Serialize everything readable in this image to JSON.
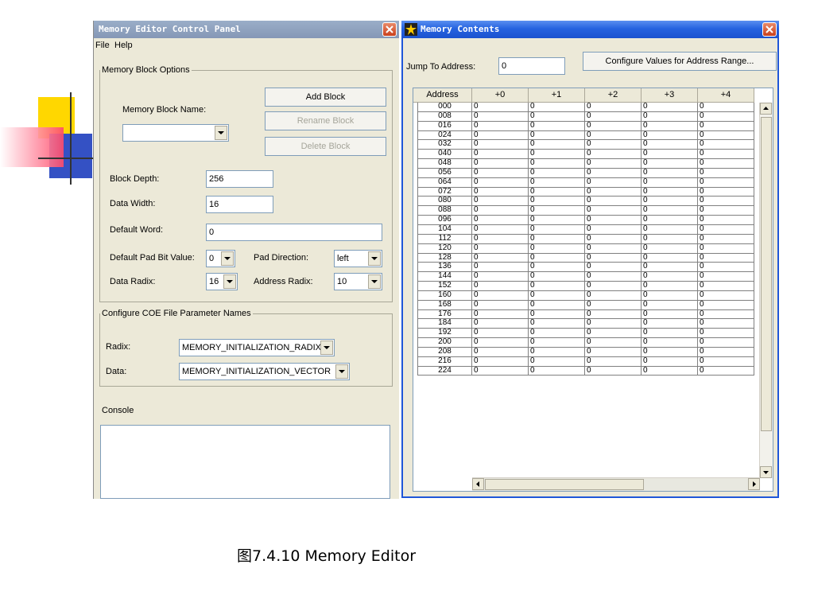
{
  "colors": {
    "titlebar_active": "#2663e0",
    "titlebar_inactive": "#8597b6",
    "window_bg": "#ece9d8",
    "close_red": "#c9401c"
  },
  "control_panel": {
    "title": "Memory Editor Control Panel",
    "menu": [
      "File",
      "Help"
    ],
    "memory_block_options": {
      "legend": "Memory Block Options",
      "name_label": "Memory Block Name:",
      "name_value": "",
      "add_button": "Add Block",
      "rename_button": "Rename Block",
      "delete_button": "Delete Block",
      "block_depth_label": "Block Depth:",
      "block_depth_value": "256",
      "data_width_label": "Data Width:",
      "data_width_value": "16",
      "default_word_label": "Default Word:",
      "default_word_value": "0",
      "pad_bit_label": "Default Pad Bit Value:",
      "pad_bit_value": "0",
      "pad_direction_label": "Pad Direction:",
      "pad_direction_value": "left",
      "data_radix_label": "Data Radix:",
      "data_radix_value": "16",
      "address_radix_label": "Address Radix:",
      "address_radix_value": "10"
    },
    "coe_params": {
      "legend": "Configure COE File Parameter Names",
      "radix_label": "Radix:",
      "radix_value": "MEMORY_INITIALIZATION_RADIX",
      "data_label": "Data:",
      "data_value": "MEMORY_INITIALIZATION_VECTOR"
    },
    "console_label": "Console"
  },
  "memory_contents": {
    "title": "Memory Contents",
    "jump_label": "Jump To Address:",
    "jump_value": "0",
    "configure_button": "Configure Values for Address Range...",
    "columns": [
      "Address",
      "+0",
      "+1",
      "+2",
      "+3",
      "+4"
    ],
    "addresses": [
      "000",
      "008",
      "016",
      "024",
      "032",
      "040",
      "048",
      "056",
      "064",
      "072",
      "080",
      "088",
      "096",
      "104",
      "112",
      "120",
      "128",
      "136",
      "144",
      "152",
      "160",
      "168",
      "176",
      "184",
      "192",
      "200",
      "208",
      "216",
      "224"
    ],
    "cell_value": "0"
  },
  "caption": "图7.4.10 Memory Editor"
}
